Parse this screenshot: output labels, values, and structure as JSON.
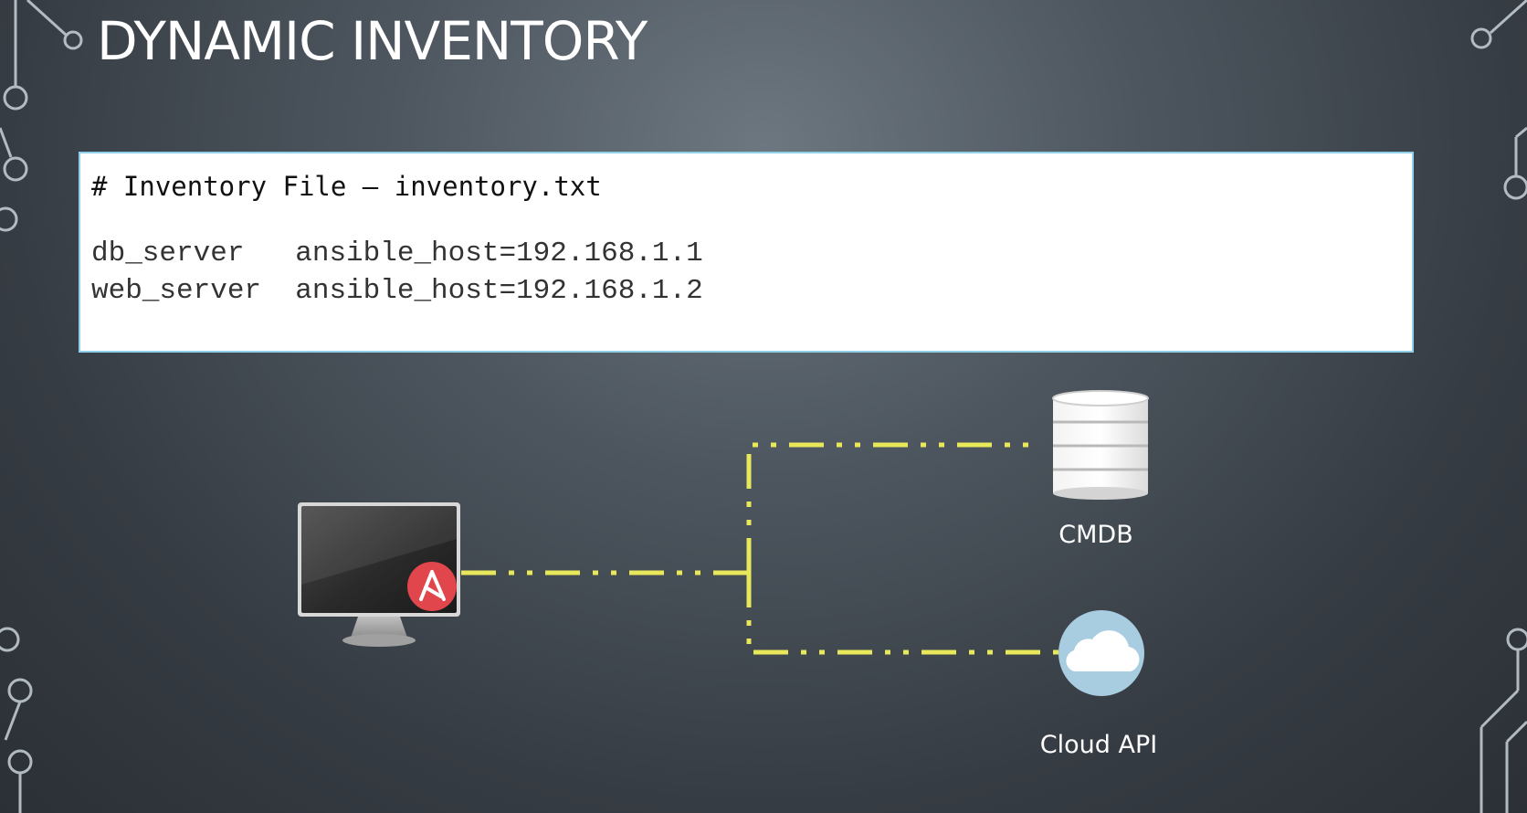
{
  "title": "DYNAMIC INVENTORY",
  "inventory_file": {
    "comment": "# Inventory File – inventory.txt",
    "lines": [
      "db_server   ansible_host=192.168.1.1",
      "web_server  ansible_host=192.168.1.2"
    ]
  },
  "diagram": {
    "nodes": {
      "ansible_controller": {
        "icon": "computer-monitor-icon",
        "badge_icon": "ansible-logo-icon",
        "badge_letter": "A"
      },
      "cmdb": {
        "label": "CMDB",
        "icon": "database-icon"
      },
      "cloud_api": {
        "label": "Cloud API",
        "icon": "cloud-icon"
      }
    },
    "connector_color": "#e8e85a",
    "badge_color": "#e0464c",
    "cloud_bg_color": "#a9cde0"
  },
  "colors": {
    "background": "#4d565f",
    "code_border": "#8fd0e8"
  }
}
